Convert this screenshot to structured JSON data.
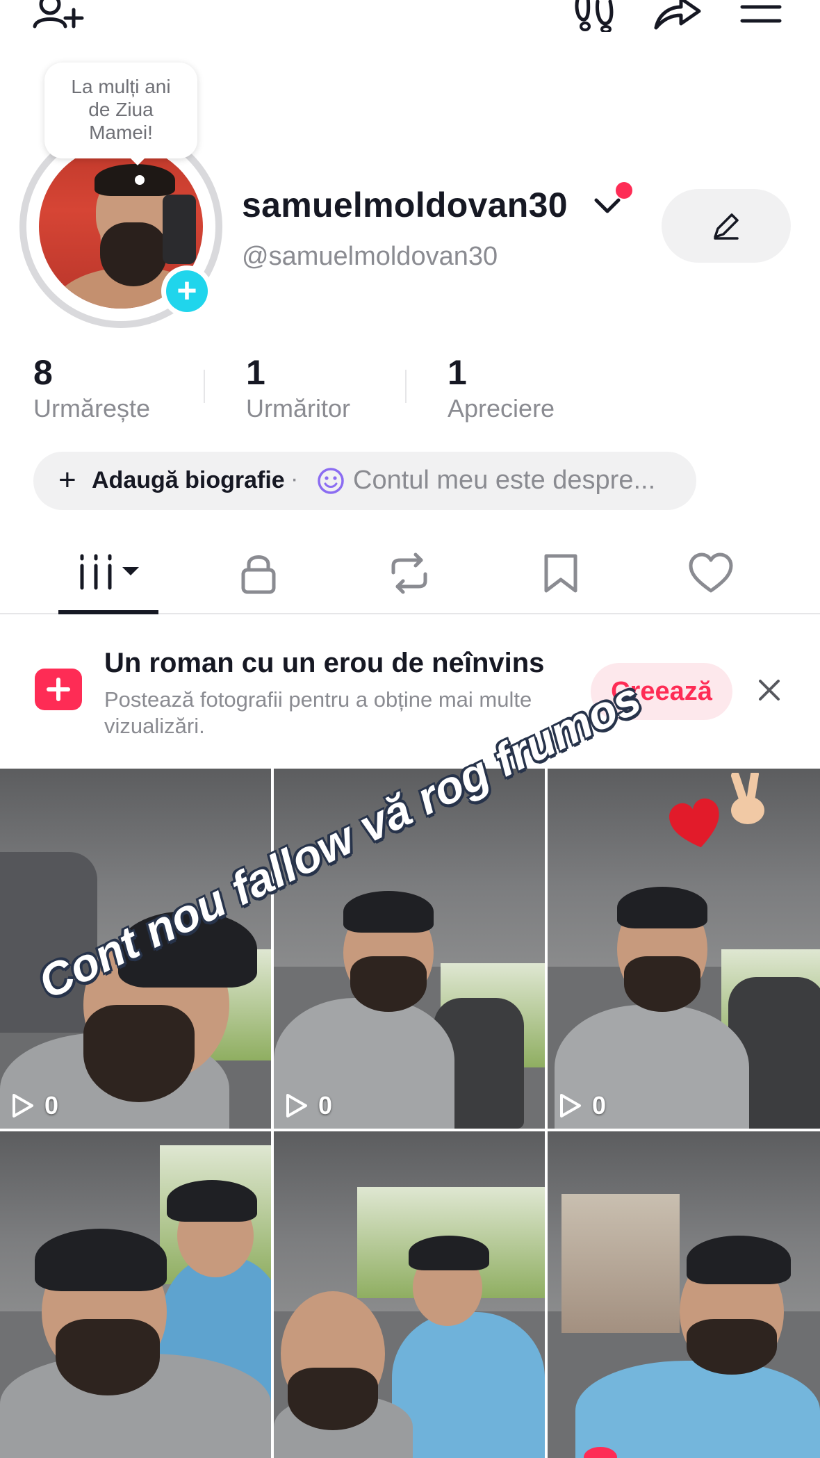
{
  "top_bar": {
    "add_friend_icon": "person-add-icon",
    "footprints_icon": "footprints-icon",
    "share_icon": "share-icon",
    "menu_icon": "hamburger-menu-icon"
  },
  "profile": {
    "story_bubble": "La mulți ani de Ziua Mamei!",
    "username": "samuelmoldovan30",
    "handle": "@samuelmoldovan30",
    "edit_icon": "pencil-icon"
  },
  "stats": [
    {
      "value": "8",
      "label": "Urmărește"
    },
    {
      "value": "1",
      "label": "Urmăritor"
    },
    {
      "value": "1",
      "label": "Apreciere"
    }
  ],
  "bio": {
    "add_label": "Adaugă biografie",
    "separator": "·",
    "about_placeholder": "Contul meu este despre..."
  },
  "tabs": [
    "videos-grid-icon",
    "lock-icon",
    "repost-icon",
    "bookmark-icon",
    "heart-icon"
  ],
  "promo": {
    "title": "Un roman cu un erou de neînvins",
    "description": "Postează fotografii pentru a obține mai multe vizualizări.",
    "create_label": "Creează"
  },
  "videos": [
    {
      "views": "0"
    },
    {
      "views": "0"
    },
    {
      "views": "0"
    },
    {
      "views": ""
    },
    {
      "views": ""
    },
    {
      "views": ""
    }
  ],
  "overlay_caption": "Cont nou fallow vă rog frumos",
  "colors": {
    "accent": "#fe2c55",
    "cyan": "#20d5ec",
    "text_primary": "#161823",
    "text_secondary": "#8a8b91",
    "pill_bg": "#f1f1f2"
  }
}
